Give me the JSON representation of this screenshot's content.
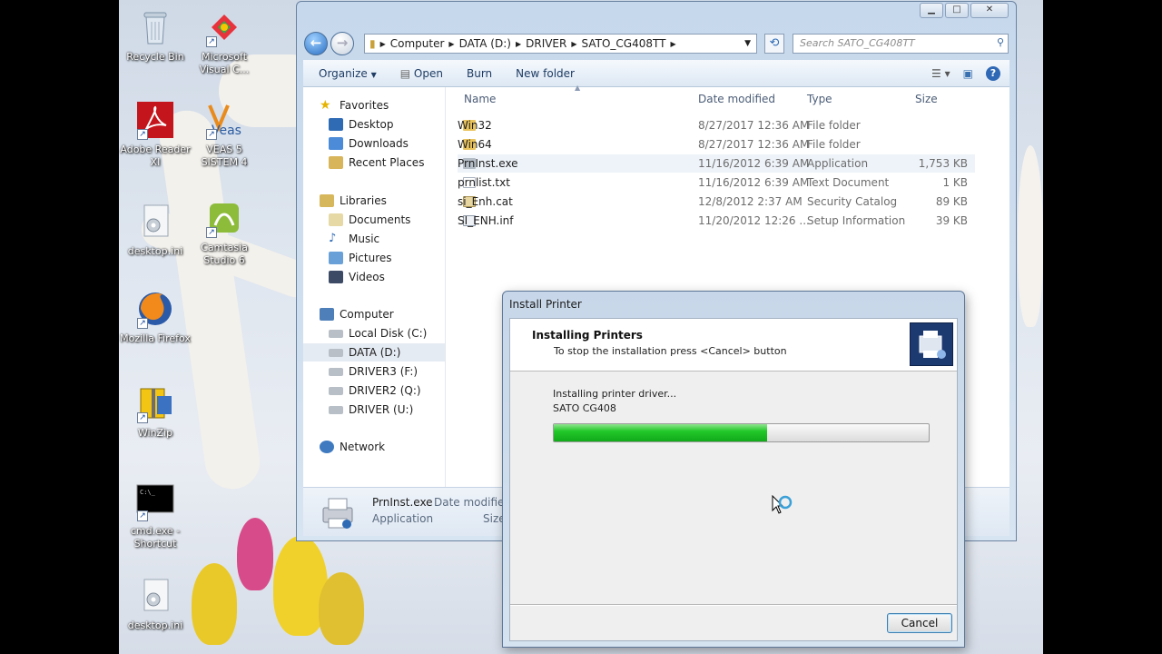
{
  "desktop": {
    "icons": [
      {
        "label": "Recycle Bin",
        "icon": "recycle-bin-icon"
      },
      {
        "label": "Microsoft Visual C...",
        "icon": "visual-studio-icon"
      },
      {
        "label": "Adobe Reader XI",
        "icon": "pdf-icon"
      },
      {
        "label": "VEAS 5 SISTEM 4",
        "icon": "veas-icon"
      },
      {
        "label": "desktop.ini",
        "icon": "settings-file-icon"
      },
      {
        "label": "Camtasia Studio 6",
        "icon": "camtasia-icon"
      },
      {
        "label": "Mozilla Firefox",
        "icon": "firefox-icon"
      },
      {
        "label": "WinZip",
        "icon": "winzip-icon"
      },
      {
        "label": "cmd.exe - Shortcut",
        "icon": "cmd-icon"
      },
      {
        "label": "desktop.ini",
        "icon": "settings-file-icon"
      }
    ]
  },
  "explorer": {
    "address": [
      "Computer",
      "DATA (D:)",
      "DRIVER",
      "SATO_CG408TT"
    ],
    "search_placeholder": "Search SATO_CG408TT",
    "toolbar": {
      "organize": "Organize",
      "open": "Open",
      "burn": "Burn",
      "new_folder": "New folder"
    },
    "nav": {
      "favorites": "Favorites",
      "desktop": "Desktop",
      "downloads": "Downloads",
      "recent": "Recent Places",
      "libraries": "Libraries",
      "documents": "Documents",
      "music": "Music",
      "pictures": "Pictures",
      "videos": "Videos",
      "computer": "Computer",
      "drive_c": "Local Disk (C:)",
      "drive_d": "DATA (D:)",
      "drive_f": "DRIVER3 (F:)",
      "drive_q": "DRIVER2 (Q:)",
      "drive_u": "DRIVER (U:)",
      "network": "Network"
    },
    "columns": {
      "name": "Name",
      "date": "Date modified",
      "type": "Type",
      "size": "Size"
    },
    "files": [
      {
        "name": "Win32",
        "date": "8/27/2017 12:36 AM",
        "type": "File folder",
        "size": "",
        "icon": "folder-icon"
      },
      {
        "name": "Win64",
        "date": "8/27/2017 12:36 AM",
        "type": "File folder",
        "size": "",
        "icon": "folder-icon"
      },
      {
        "name": "PrnInst.exe",
        "date": "11/16/2012 6:39 AM",
        "type": "Application",
        "size": "1,753 KB",
        "icon": "application-icon"
      },
      {
        "name": "prnlist.txt",
        "date": "11/16/2012 6:39 AM",
        "type": "Text Document",
        "size": "1 KB",
        "icon": "text-file-icon"
      },
      {
        "name": "si_Enh.cat",
        "date": "12/8/2012 2:37 AM",
        "type": "Security Catalog",
        "size": "89 KB",
        "icon": "catalog-icon"
      },
      {
        "name": "SI_ENH.inf",
        "date": "11/20/2012 12:26 ...",
        "type": "Setup Information",
        "size": "39 KB",
        "icon": "inf-file-icon"
      }
    ],
    "details": {
      "name": "PrnInst.exe",
      "type": "Application",
      "date_label": "Date modified",
      "size_label": "Size"
    }
  },
  "dialog": {
    "title": "Install Printer",
    "heading": "Installing Printers",
    "subheading": "To stop the installation press <Cancel> button",
    "status": "Installing printer driver...",
    "printer": "SATO CG408",
    "progress": 0.57,
    "cancel": "Cancel"
  }
}
